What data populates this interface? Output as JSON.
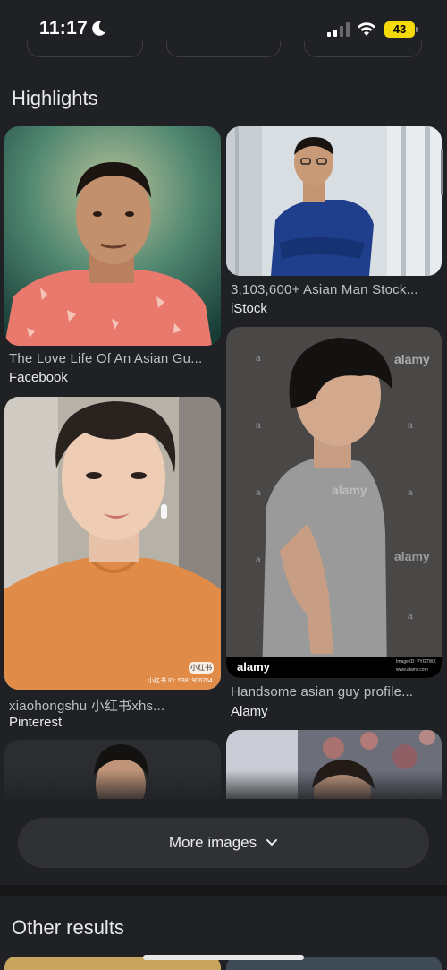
{
  "status_bar": {
    "time": "11:17",
    "battery": "43",
    "battery_color": "#f5d90a"
  },
  "highlights": {
    "title": "Highlights",
    "items": [
      {
        "caption": "The Love Life Of An Asian Gu...",
        "source": "Facebook"
      },
      {
        "caption": "3,103,600+ Asian Man Stock...",
        "source": "iStock"
      },
      {
        "caption": "xiaohongshu 小红书xhs...",
        "source": "Pinterest"
      },
      {
        "caption": "Handsome asian guy profile...",
        "source": "Alamy"
      }
    ],
    "watermarks": {
      "alamy": "alamy",
      "alamy_a": "a",
      "xhs_badge": "小红书",
      "xhs_id": "小红书 ID: 5381906254",
      "alamy_image_id": "Image ID: PYGTWX",
      "alamy_site": "www.alamy.com"
    }
  },
  "more_images": {
    "label": "More images",
    "icon": "chevron-down-icon"
  },
  "other_results": {
    "title": "Other results"
  }
}
